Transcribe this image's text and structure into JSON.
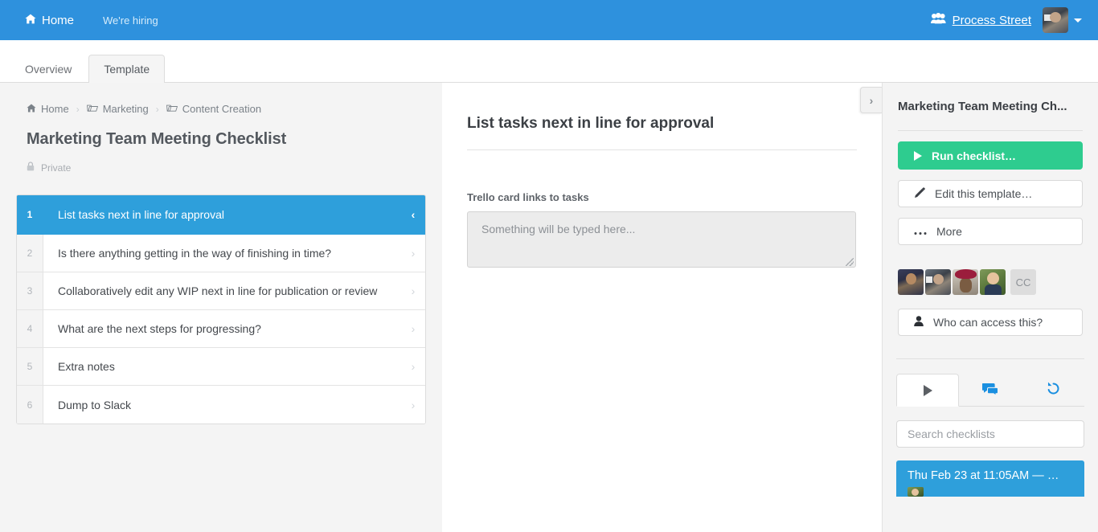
{
  "topnav": {
    "home_label": "Home",
    "home_icon": "home-icon",
    "hiring_label": "We're hiring",
    "org_label": "Process Street",
    "org_icon": "users-group-icon",
    "avatar_icon": "user-avatar",
    "caret_icon": "chevron-down-icon"
  },
  "tabs": [
    {
      "label": "Overview",
      "active": false
    },
    {
      "label": "Template",
      "active": true
    }
  ],
  "left": {
    "breadcrumb": [
      {
        "label": "Home",
        "icon": "home-icon"
      },
      {
        "label": "Marketing",
        "icon": "folder-icon"
      },
      {
        "label": "Content Creation",
        "icon": "folder-icon"
      }
    ],
    "breadcrumb_separator": "›",
    "title": "Marketing Team Meeting Checklist",
    "privacy_label": "Private",
    "privacy_icon": "lock-icon",
    "tasks": [
      {
        "num": "1",
        "label": "List tasks next in line for approval",
        "active": true,
        "arrow": "‹"
      },
      {
        "num": "2",
        "label": "Is there anything getting in the way of finishing in time?",
        "active": false,
        "arrow": "›"
      },
      {
        "num": "3",
        "label": "Collaboratively edit any WIP next in line for publication or review",
        "active": false,
        "arrow": "›"
      },
      {
        "num": "4",
        "label": "What are the next steps for progressing?",
        "active": false,
        "arrow": "›"
      },
      {
        "num": "5",
        "label": "Extra notes",
        "active": false,
        "arrow": "›"
      },
      {
        "num": "6",
        "label": "Dump to Slack",
        "active": false,
        "arrow": "›"
      }
    ]
  },
  "center": {
    "task_heading": "List tasks next in line for approval",
    "field_label": "Trello card links to tasks",
    "field_placeholder": "Something will be typed here...",
    "field_value": ""
  },
  "collapse_handle": {
    "icon": "chevron-right-icon",
    "glyph": "›"
  },
  "right": {
    "title": "Marketing Team Meeting Ch...",
    "buttons": [
      {
        "label": "Run checklist…",
        "icon": "play-icon",
        "style": "primary"
      },
      {
        "label": "Edit this template…",
        "icon": "pencil-icon",
        "style": "plain"
      },
      {
        "label": "More",
        "icon": "ellipsis-icon",
        "style": "plain"
      }
    ],
    "members": {
      "avatar_count": 4,
      "overflow_initials": "CC"
    },
    "access_button": {
      "label": "Who can access this?",
      "icon": "person-icon"
    },
    "panel_tabs": [
      {
        "icon": "play-icon",
        "active": true
      },
      {
        "icon": "comments-icon",
        "active": false
      },
      {
        "icon": "history-icon",
        "active": false
      }
    ],
    "search_placeholder": "Search checklists",
    "search_value": "",
    "checklists": [
      {
        "title": "Thu Feb 23 at 11:05AM — …",
        "active": true
      }
    ]
  },
  "colors": {
    "brand_blue": "#2e91dd",
    "accent_blue": "#2e9fdb",
    "success_green": "#2ecc8f",
    "panel_bg": "#f4f4f4",
    "border": "#dddddd"
  }
}
